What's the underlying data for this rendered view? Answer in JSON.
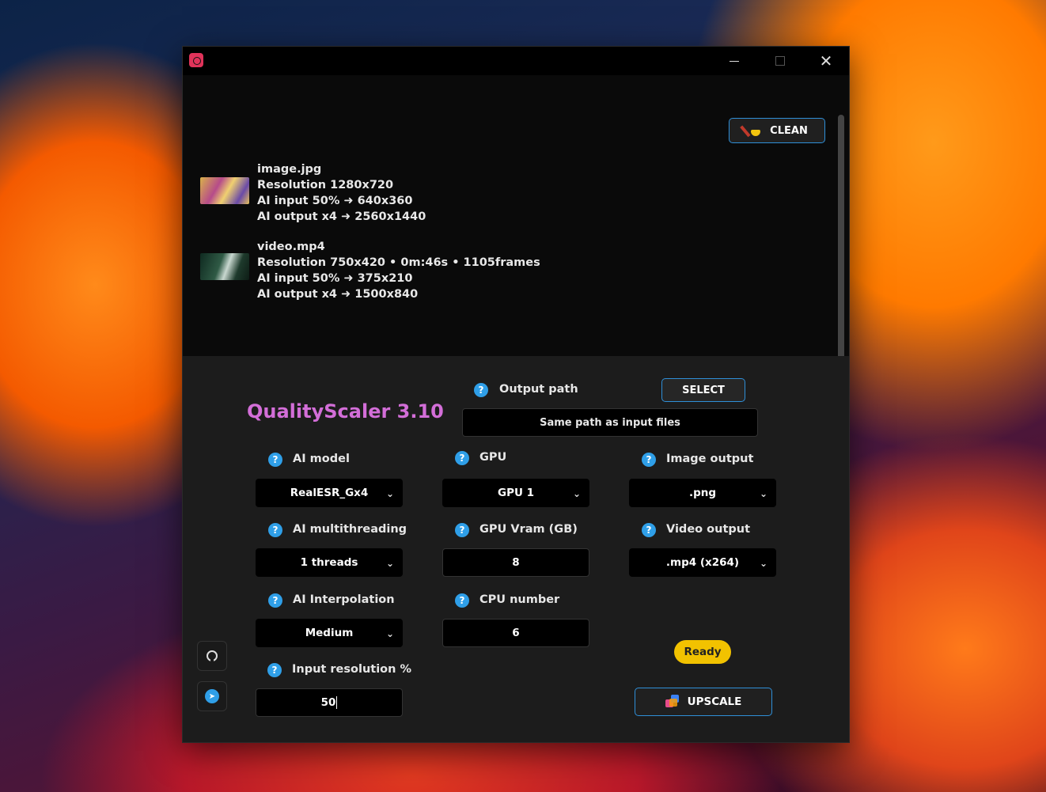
{
  "window": {
    "controls": {
      "minimize": "—",
      "maximize": "□",
      "close": "✕"
    },
    "clean_label": "CLEAN"
  },
  "files": [
    {
      "name": "image.jpg",
      "line1": "Resolution 1280x720",
      "line2": "AI input 50% ➜ 640x360",
      "line3": "AI output x4 ➜ 2560x1440"
    },
    {
      "name": "video.mp4",
      "line1": "Resolution 750x420 • 0m:46s • 1105frames",
      "line2": "AI input 50% ➜ 375x210",
      "line3": "AI output x4 ➜ 1500x840"
    }
  ],
  "app_title": "QualityScaler 3.10",
  "output_path": {
    "label": "Output path",
    "select_label": "SELECT",
    "value": "Same path as input files"
  },
  "settings": {
    "ai_model": {
      "label": "AI model",
      "value": "RealESR_Gx4"
    },
    "gpu": {
      "label": "GPU",
      "value": "GPU 1"
    },
    "image_output": {
      "label": "Image output",
      "value": ".png"
    },
    "ai_multithreading": {
      "label": "AI multithreading",
      "value": "1 threads"
    },
    "gpu_vram": {
      "label": "GPU Vram (GB)",
      "value": "8"
    },
    "video_output": {
      "label": "Video output",
      "value": ".mp4 (x264)"
    },
    "ai_interpolation": {
      "label": "AI Interpolation",
      "value": "Medium"
    },
    "cpu_number": {
      "label": "CPU number",
      "value": "6"
    },
    "input_resolution": {
      "label": "Input resolution %",
      "value": "50"
    }
  },
  "help_glyph": "?",
  "status": "Ready",
  "upscale_label": "UPSCALE",
  "icons": {
    "github": "github-icon",
    "telegram": "telegram-icon"
  }
}
